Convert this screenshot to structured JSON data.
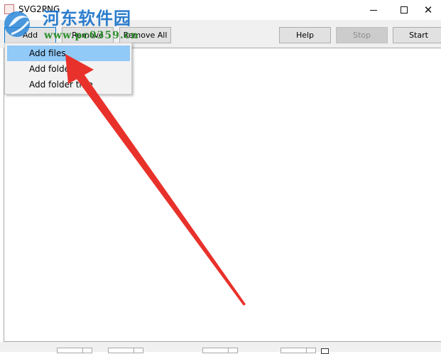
{
  "window": {
    "title": "SVG2PNG",
    "minimize_icon": "minimize-icon",
    "maximize_icon": "maximize-icon",
    "close_glyph": "✕"
  },
  "watermark": {
    "site_name": "河东软件园",
    "url": "www.pc0359.cn",
    "logo_color": "#1a73c9",
    "url_color": "#2f8f2f"
  },
  "toolbar": {
    "add_label": "Add",
    "remove_label": "Remove",
    "remove_all_label": "Remove All",
    "help_label": "Help",
    "stop_label": "Stop",
    "start_label": "Start"
  },
  "add_menu": {
    "items": [
      {
        "label": "Add files",
        "highlighted": true
      },
      {
        "label": "Add folder",
        "highlighted": false
      },
      {
        "label": "Add folder tree",
        "highlighted": false
      }
    ]
  },
  "annotation": {
    "arrow_color": "#e8312a"
  },
  "colors": {
    "menu_highlight": "#91c9f7",
    "focus_border": "#0078d7"
  }
}
